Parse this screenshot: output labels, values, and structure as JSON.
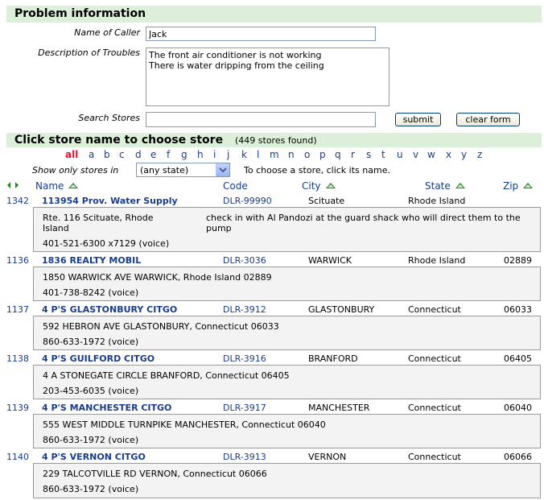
{
  "problem": {
    "title": "Problem information",
    "caller_label": "Name of Caller",
    "caller_value": "Jack",
    "desc_label": "Description of Troubles",
    "desc_line1": "The front air conditioner is not working",
    "desc_line2": "There is water dripping from the ceiling",
    "search_label": "Search Stores",
    "search_value": "",
    "submit": "submit",
    "clear": "clear form"
  },
  "stores_header": {
    "title": "Click store name to choose store",
    "count": "(449 stores found)"
  },
  "letters": [
    "all",
    "a",
    "b",
    "c",
    "d",
    "e",
    "f",
    "g",
    "h",
    "i",
    "j",
    "k",
    "l",
    "m",
    "n",
    "o",
    "p",
    "q",
    "r",
    "s",
    "t",
    "u",
    "v",
    "w",
    "x",
    "y",
    "z"
  ],
  "filter": {
    "label": "Show only stores in",
    "selected": "(any state)",
    "hint": "To choose a store, click its name."
  },
  "columns": {
    "arrows": "<>",
    "name": "Name",
    "code": "Code",
    "city": "City",
    "state": "State",
    "zip": "Zip"
  },
  "stores": [
    {
      "id": "1342",
      "name": "113954 Prov. Water Supply",
      "code": "DLR-99990",
      "city": "Scituate",
      "state": "Rhode Island",
      "zip": "",
      "addr1": "Rte. 116  Scituate, Rhode",
      "addr2": "Island",
      "phone": "401-521-6300 x7129 (voice)",
      "note1": "check in with Al Pandozi at the guard shack who will direct them to the",
      "note2": "pump"
    },
    {
      "id": "1136",
      "name": "1836 REALTY MOBIL",
      "code": "DLR-3036",
      "city": "WARWICK",
      "state": "Rhode Island",
      "zip": "02889",
      "addr": "1850 WARWICK AVE  WARWICK, Rhode Island 02889",
      "phone": "401-738-8242 (voice)"
    },
    {
      "id": "1137",
      "name": "4 P'S GLASTONBURY CITGO",
      "code": "DLR-3912",
      "city": "GLASTONBURY",
      "state": "Connecticut",
      "zip": "06033",
      "addr": "592 HEBRON AVE  GLASTONBURY, Connecticut 06033",
      "phone": "860-633-1972 (voice)"
    },
    {
      "id": "1138",
      "name": "4 P'S GUILFORD CITGO",
      "code": "DLR-3916",
      "city": "BRANFORD",
      "state": "Connecticut",
      "zip": "06405",
      "addr": "4 A STONEGATE CIRCLE  BRANFORD, Connecticut 06405",
      "phone": "203-453-6035 (voice)"
    },
    {
      "id": "1139",
      "name": "4 P'S MANCHESTER CITGO",
      "code": "DLR-3917",
      "city": "MANCHESTER",
      "state": "Connecticut",
      "zip": "06040",
      "addr": "555 WEST MIDDLE TURNPIKE  MANCHESTER, Connecticut 06040",
      "phone": "860-633-1972 (voice)"
    },
    {
      "id": "1140",
      "name": "4 P'S VERNON CITGO",
      "code": "DLR-3913",
      "city": "VERNON",
      "state": "Connecticut",
      "zip": "06066",
      "addr": "229 TALCOTVILLE RD  VERNON, Connecticut 06066",
      "phone": "860-633-1972 (voice)"
    }
  ]
}
